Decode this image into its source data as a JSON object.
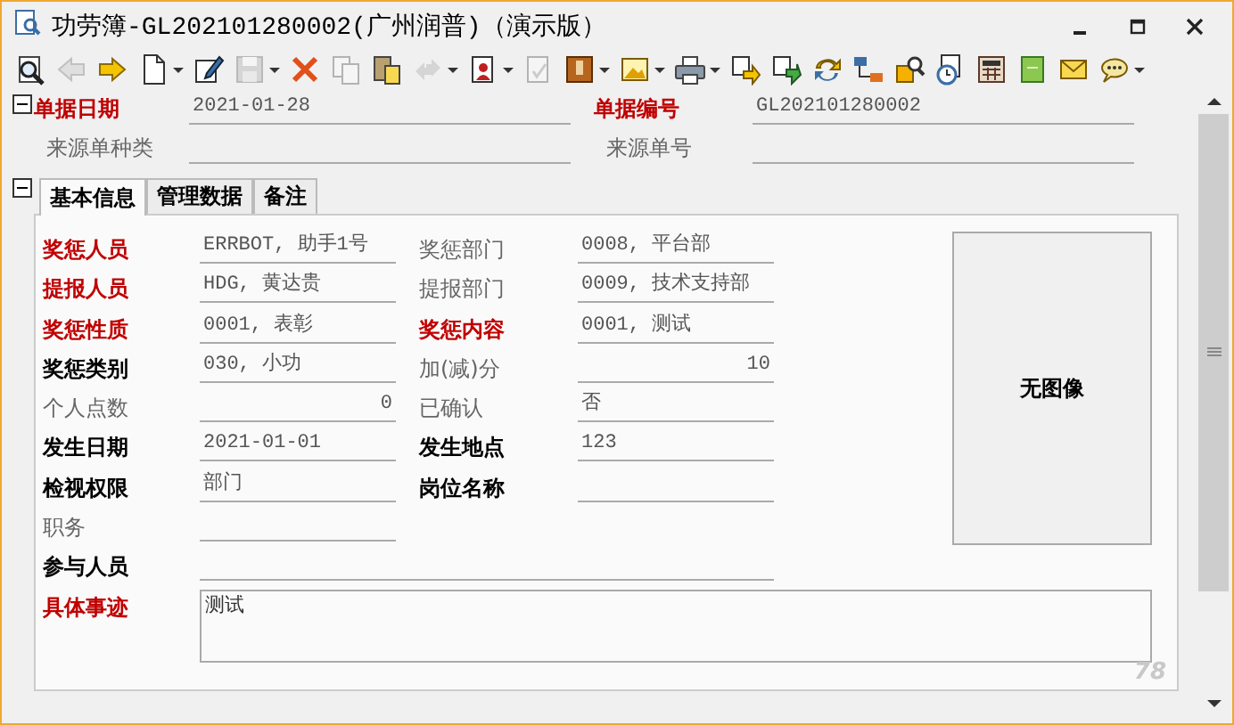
{
  "window": {
    "title": "功劳簿-GL202101280002(广州润普)（演示版）"
  },
  "toolbar": [
    {
      "disabled": false,
      "dropdown": false
    },
    {
      "disabled": true,
      "dropdown": false
    },
    {
      "disabled": false,
      "dropdown": false
    },
    {
      "disabled": false,
      "dropdown": true
    },
    {
      "disabled": false,
      "dropdown": false
    },
    {
      "disabled": true,
      "dropdown": true
    },
    {
      "disabled": false,
      "dropdown": false
    },
    {
      "disabled": true,
      "dropdown": false
    },
    {
      "disabled": false,
      "dropdown": false
    },
    {
      "disabled": true,
      "dropdown": true
    },
    {
      "disabled": false,
      "dropdown": true
    },
    {
      "disabled": true,
      "dropdown": false
    },
    {
      "disabled": false,
      "dropdown": true
    },
    {
      "disabled": false,
      "dropdown": true
    },
    {
      "disabled": false,
      "dropdown": true
    },
    {
      "disabled": false,
      "dropdown": false
    },
    {
      "disabled": false,
      "dropdown": false
    },
    {
      "disabled": false,
      "dropdown": false
    },
    {
      "disabled": false,
      "dropdown": false
    },
    {
      "disabled": false,
      "dropdown": false
    },
    {
      "disabled": false,
      "dropdown": false
    },
    {
      "disabled": false,
      "dropdown": false
    },
    {
      "disabled": false,
      "dropdown": false
    },
    {
      "disabled": false,
      "dropdown": false
    },
    {
      "disabled": false,
      "dropdown": true
    }
  ],
  "header": {
    "expanded": true,
    "fields": [
      {
        "label": {
          "text": "单据日期",
          "kind": "required"
        },
        "value": "2021-01-28"
      },
      {
        "label": {
          "text": "单据编号",
          "kind": "required"
        },
        "value": "GL202101280002"
      },
      {
        "label": {
          "text": "来源单种类",
          "kind": "muted"
        }
      },
      {
        "label": {
          "text": "来源单号",
          "kind": "muted"
        }
      }
    ]
  },
  "details": {
    "expanded": true,
    "tabs": [
      {
        "label": "基本信息",
        "selected": true
      },
      {
        "label": "管理数据",
        "selected": false
      },
      {
        "label": "备注",
        "selected": false
      }
    ],
    "rows": [
      [
        {
          "label": {
            "text": "奖惩人员",
            "kind": "required"
          },
          "input": {
            "kind": "text",
            "value": "ERRBOT, 助手1号"
          }
        },
        {
          "label": {
            "text": "奖惩部门",
            "kind": "muted"
          },
          "input": {
            "kind": "text",
            "value": "0008, 平台部"
          }
        }
      ],
      [
        {
          "label": {
            "text": "提报人员",
            "kind": "required"
          },
          "input": {
            "kind": "text",
            "value": "HDG, 黄达贵"
          }
        },
        {
          "label": {
            "text": "提报部门",
            "kind": "muted"
          },
          "input": {
            "kind": "text",
            "value": "0009, 技术支持部"
          }
        }
      ],
      [
        {
          "label": {
            "text": "奖惩性质",
            "kind": "required"
          },
          "input": {
            "kind": "text",
            "value": "0001, 表彰"
          }
        },
        {
          "label": {
            "text": "奖惩内容",
            "kind": "required"
          },
          "input": {
            "kind": "text",
            "value": "0001, 测试"
          }
        }
      ],
      [
        {
          "label": {
            "text": "奖惩类别",
            "kind": "normal"
          },
          "input": {
            "kind": "text",
            "value": "030, 小功"
          }
        },
        {
          "label": {
            "text": "加(减)分",
            "kind": "muted"
          },
          "input": {
            "kind": "number",
            "value": "10"
          }
        }
      ],
      [
        {
          "label": {
            "text": "个人点数",
            "kind": "muted"
          },
          "input": {
            "kind": "number",
            "value": "0"
          }
        },
        {
          "label": {
            "text": "已确认",
            "kind": "muted"
          },
          "input": {
            "kind": "text",
            "value": "否"
          }
        }
      ],
      [
        {
          "label": {
            "text": "发生日期",
            "kind": "normal"
          },
          "input": {
            "kind": "text",
            "value": "2021-01-01"
          }
        },
        {
          "label": {
            "text": "发生地点",
            "kind": "normal"
          },
          "input": {
            "kind": "text",
            "value": "123"
          }
        }
      ],
      [
        {
          "label": {
            "text": "检视权限",
            "kind": "normal"
          },
          "input": {
            "kind": "text",
            "value": "部门"
          }
        },
        {
          "label": {
            "text": "岗位名称",
            "kind": "normal"
          },
          "input": {
            "kind": "text"
          }
        }
      ],
      [
        {
          "label": {
            "text": "职务",
            "kind": "muted"
          },
          "input": {
            "kind": "text"
          }
        }
      ],
      [
        {
          "label": {
            "text": "参与人员",
            "kind": "normal"
          },
          "input": {
            "kind": "wide"
          }
        }
      ],
      [
        {
          "label": {
            "text": "具体事迹",
            "kind": "required"
          },
          "input": {
            "kind": "memo",
            "value": "测试"
          }
        }
      ]
    ],
    "photo": {
      "placeholder": "无图像"
    },
    "corner_mark": "78"
  }
}
